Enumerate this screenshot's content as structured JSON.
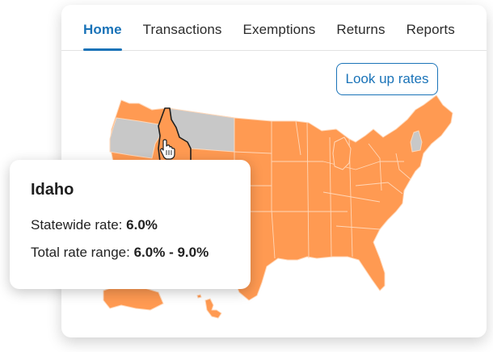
{
  "nav": {
    "tabs": [
      {
        "label": "Home",
        "active": true
      },
      {
        "label": "Transactions",
        "active": false
      },
      {
        "label": "Exemptions",
        "active": false
      },
      {
        "label": "Returns",
        "active": false
      },
      {
        "label": "Reports",
        "active": false
      }
    ]
  },
  "toolbar": {
    "lookup_label": "Look up rates"
  },
  "map": {
    "selected_state": "Idaho",
    "colors": {
      "taxed": "#ff9a52",
      "no_data": "#c8c8c8",
      "selected_outline": "#1f1f1f",
      "state_border": "#ffd7b8"
    },
    "gray_states": [
      "Oregon",
      "Montana",
      "New Hampshire"
    ],
    "cursor_icon": "hand-pointer-icon"
  },
  "popup": {
    "title": "Idaho",
    "statewide_label": "Statewide rate:",
    "statewide_value": "6.0%",
    "range_label": "Total rate range:",
    "range_value": "6.0% - 9.0%"
  }
}
